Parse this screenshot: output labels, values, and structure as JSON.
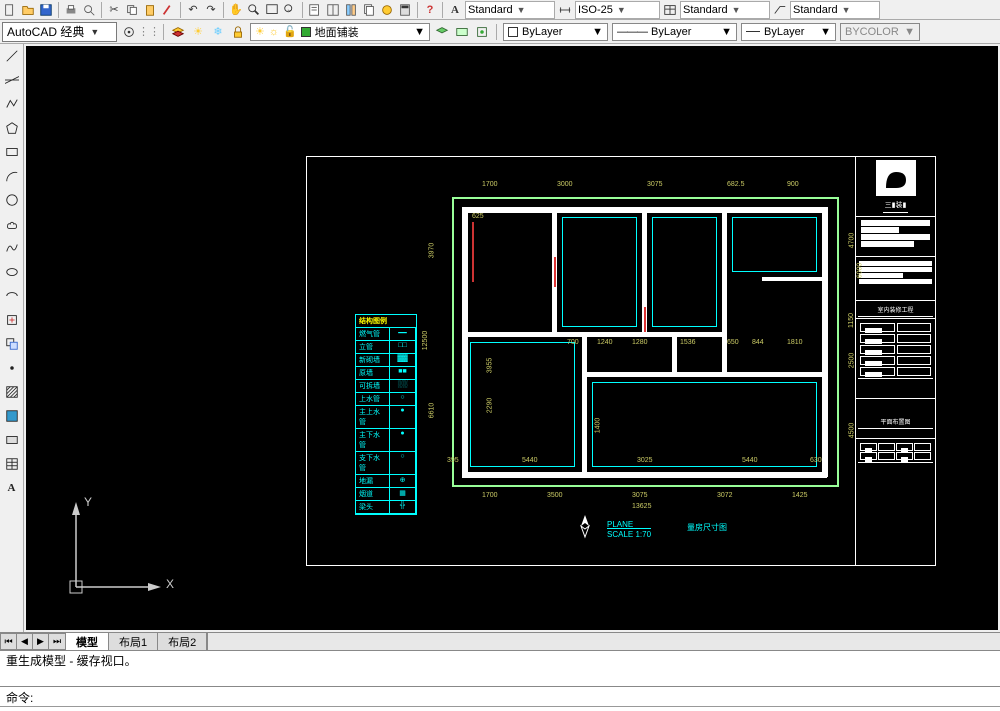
{
  "topbar": {
    "styles": [
      "Standard",
      "ISO-25",
      "Standard",
      "Standard"
    ]
  },
  "workspace": {
    "name": "AutoCAD 经典",
    "layer": "地面铺装"
  },
  "properties": {
    "color": "ByLayer",
    "linetype": "ByLayer",
    "lineweight": "ByLayer",
    "plotstyle": "BYCOLOR"
  },
  "tabs": {
    "model": "模型",
    "layout1": "布局1",
    "layout2": "布局2"
  },
  "command": {
    "history": "重生成模型 - 缓存视口。",
    "prompt": "命令:"
  },
  "ucs": {
    "x": "X",
    "y": "Y"
  },
  "drawing": {
    "plane_label": "PLANE",
    "scale_label": "SCALE  1:70",
    "layout_title": "量房尺寸图",
    "title_block": {
      "project": "室内装修工程",
      "drawing": "平面布置图"
    },
    "dims_top": [
      "1700",
      "3000",
      "3075",
      "682.5",
      "900"
    ],
    "dims_left": [
      "3970",
      "12500",
      "6610"
    ],
    "dims_right": [
      "4700",
      "6000",
      "1150",
      "2500",
      "4500"
    ],
    "dims_bottom": [
      "1700",
      "3500",
      "3075",
      "3072",
      "1425"
    ],
    "dims_bottom_total": "13625",
    "dims_inner": [
      "700",
      "1240",
      "1280",
      "1536",
      "650",
      "844",
      "1810",
      "5440",
      "3025",
      "5440",
      "630",
      "395",
      "2290",
      "1400",
      "3955",
      "625"
    ],
    "legend": {
      "title": "结构图例",
      "rows": [
        [
          "燃气管",
          "━━"
        ],
        [
          "立管",
          "□□"
        ],
        [
          "新砌墙",
          "▓▓"
        ],
        [
          "原墙",
          "■■"
        ],
        [
          "可拆墙",
          "░░"
        ],
        [
          "上水管",
          "○"
        ],
        [
          "主上水管",
          "●"
        ],
        [
          "主下水管",
          "●"
        ],
        [
          "支下水管",
          "○"
        ],
        [
          "地漏",
          "⊕"
        ],
        [
          "烟道",
          "▦"
        ],
        [
          "梁头",
          "╬"
        ]
      ]
    }
  }
}
